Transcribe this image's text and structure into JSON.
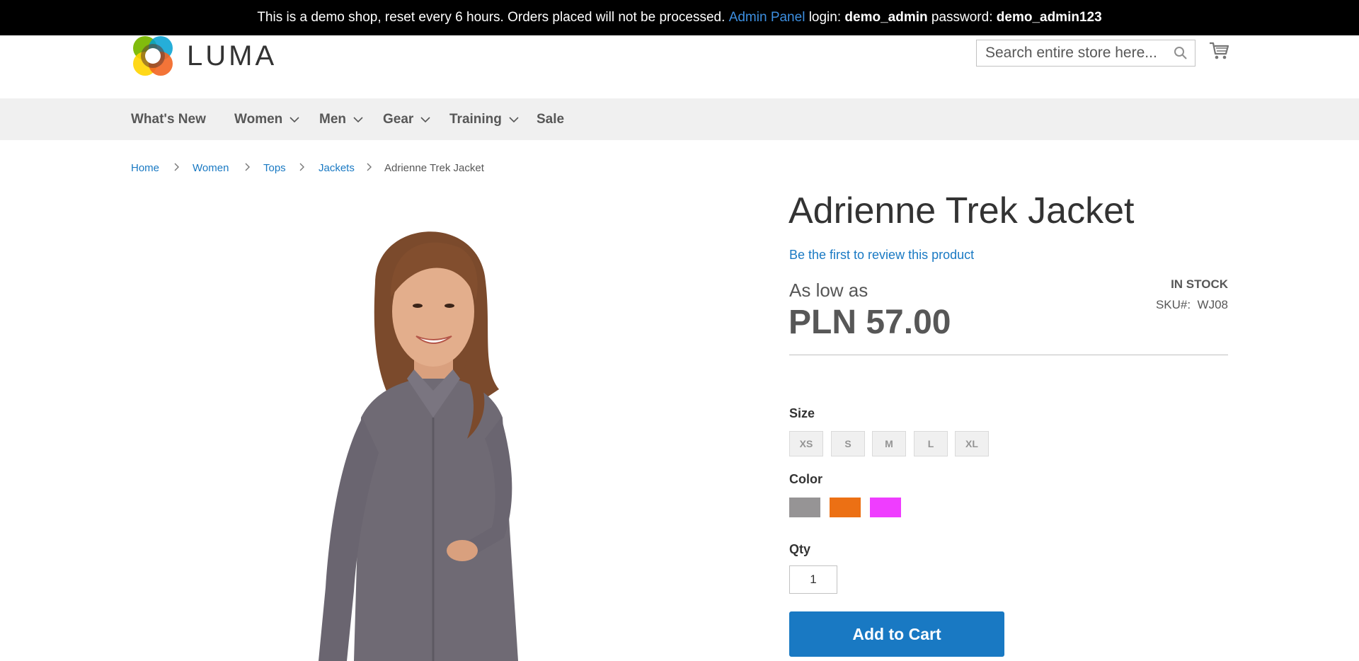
{
  "banner": {
    "text_before": "This is a demo shop, reset every 6 hours. Orders placed will not be processed. ",
    "admin_link": "Admin Panel",
    "login_label": " login: ",
    "login_value": "demo_admin",
    "password_label": " password: ",
    "password_value": "demo_admin123"
  },
  "header": {
    "logo_text": "LUMA",
    "search_placeholder": "Search entire store here...",
    "icons": {
      "search": "search-icon",
      "cart": "cart-icon"
    }
  },
  "nav": {
    "items": [
      {
        "label": "What's New",
        "has_dropdown": false
      },
      {
        "label": "Women",
        "has_dropdown": true
      },
      {
        "label": "Men",
        "has_dropdown": true
      },
      {
        "label": "Gear",
        "has_dropdown": true
      },
      {
        "label": "Training",
        "has_dropdown": true
      },
      {
        "label": "Sale",
        "has_dropdown": false
      }
    ]
  },
  "breadcrumbs": [
    "Home",
    "Women",
    "Tops",
    "Jackets",
    "Adrienne Trek Jacket"
  ],
  "product": {
    "title": "Adrienne Trek Jacket",
    "review_link": "Be the first to review this product",
    "price_prefix": "As low as",
    "price": "PLN 57.00",
    "stock": "IN STOCK",
    "sku_label": "SKU#:",
    "sku": "WJ08",
    "size_label": "Size",
    "sizes": [
      "XS",
      "S",
      "M",
      "L",
      "XL"
    ],
    "color_label": "Color",
    "colors": [
      "#969495",
      "#ec7014",
      "#ef3dff"
    ],
    "qty_label": "Qty",
    "qty": "1",
    "add_to_cart": "Add to Cart"
  },
  "colors": {
    "accent": "#1979c3",
    "banner_bg": "#000000",
    "nav_bg": "#f0f0f0"
  }
}
